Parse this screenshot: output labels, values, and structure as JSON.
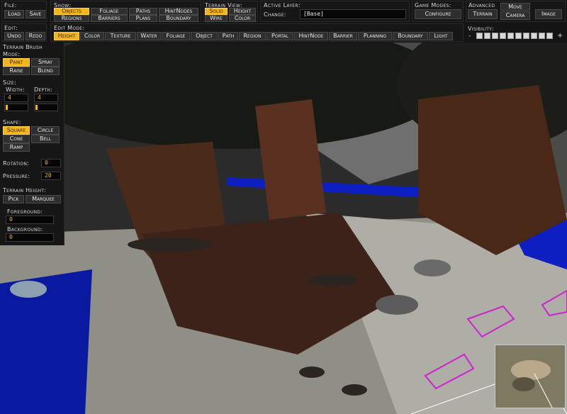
{
  "file": {
    "label": "File:",
    "load": "Load",
    "save": "Save"
  },
  "edit": {
    "label": "Edit:",
    "undo": "Undo",
    "redo": "Redo"
  },
  "show": {
    "label": "Show:",
    "buttons": [
      "Objects",
      "Foliage",
      "Paths",
      "HintNodes",
      "Regions",
      "Barriers",
      "Plans",
      "Boundary"
    ],
    "active": "Objects"
  },
  "terrain_view": {
    "label": "Terrain View:",
    "buttons": [
      "Solid",
      "Height",
      "Wire",
      "Color"
    ],
    "active": "Solid"
  },
  "active_layer": {
    "label": "Active Layer:",
    "change_label": "Change:",
    "value": "[Base]"
  },
  "game_modes": {
    "label": "Game Modes:",
    "configure": "Configure"
  },
  "advanced": {
    "label": "Advanced",
    "move": "Move",
    "terrain": "Terrain",
    "camera": "Camera",
    "image": "Image"
  },
  "edit_mode": {
    "label": "Edit Mode:",
    "buttons": [
      "Height",
      "Color",
      "Texture",
      "Water",
      "Foliage",
      "Object",
      "Path",
      "Region",
      "Portal",
      "HintNode",
      "Barrier",
      "Planning",
      "Boundary",
      "Light"
    ],
    "active": "Height"
  },
  "visibility": {
    "label": "Visibility:",
    "minus": "-",
    "plus": "+",
    "boxes": 10
  },
  "terrain_brush": {
    "title": "Terrain Brush",
    "mode_label": "Mode:",
    "modes": [
      "Paint",
      "Spray",
      "Raise",
      "Blend"
    ],
    "active_mode": "Paint",
    "size_label": "Size:",
    "width_label": "Width:",
    "width_value": "4",
    "depth_label": "Depth:",
    "depth_value": "4",
    "shape_label": "Shape:",
    "shapes": [
      "Square",
      "Circle",
      "Cone",
      "Bell",
      "Ramp"
    ],
    "active_shape": "Square",
    "rotation_label": "Rotation:",
    "rotation_value": "0",
    "pressure_label": "Pressure:",
    "pressure_value": "20",
    "terrain_height_label": "Terrain Height:",
    "pick": "Pick",
    "marquee": "Marquee",
    "foreground_label": "Foreground:",
    "foreground_value": "0",
    "background_label": "Background:",
    "background_value": "0"
  },
  "colors": {
    "accent": "#f2b51c",
    "panel": "#161616",
    "selection": "#d020d0"
  }
}
